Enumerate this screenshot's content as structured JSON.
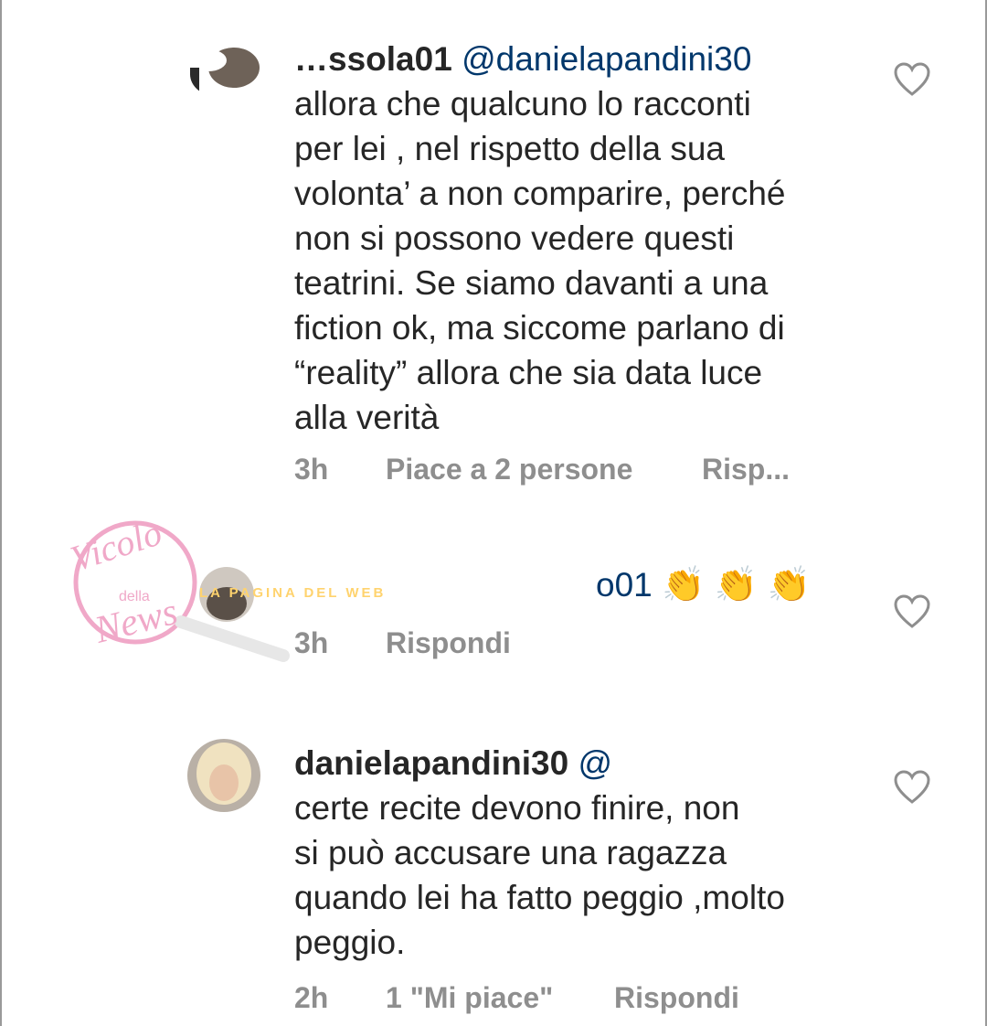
{
  "comments": [
    {
      "username": "…ssola01",
      "mention": "@danielapandini30",
      "text": "allora che qualcuno lo racconti\nper lei , nel rispetto della sua\nvolonta’ a non comparire, perché\nnon si possono vedere questi\nteatrini. Se siamo davanti a una\nfiction ok, ma siccome parlano di\n“reality” allora che sia data luce\nalla verità",
      "time": "3h",
      "likes": "Piace a 2 persone",
      "reply": "Risp..."
    },
    {
      "mention_tail": "o01",
      "emoji": "👏 👏 👏",
      "time": "3h",
      "reply": "Rispondi"
    },
    {
      "username": "danielapandini30",
      "mention": "@",
      "text": "certe recite devono finire, non\nsi può accusare una ragazza\nquando lei ha fatto peggio ,molto\npeggio.",
      "time": "2h",
      "likes": "1 \"Mi piace\"",
      "reply": "Rispondi"
    }
  ],
  "watermark": {
    "line1": "Vicolo",
    "line2": "della",
    "line3": "News",
    "banner": "LA PAGINA DEL WEB"
  },
  "colors": {
    "text": "#262626",
    "meta": "#8e8e8e",
    "mention": "#00376b",
    "watermark_pink": "#f0a8c8"
  }
}
